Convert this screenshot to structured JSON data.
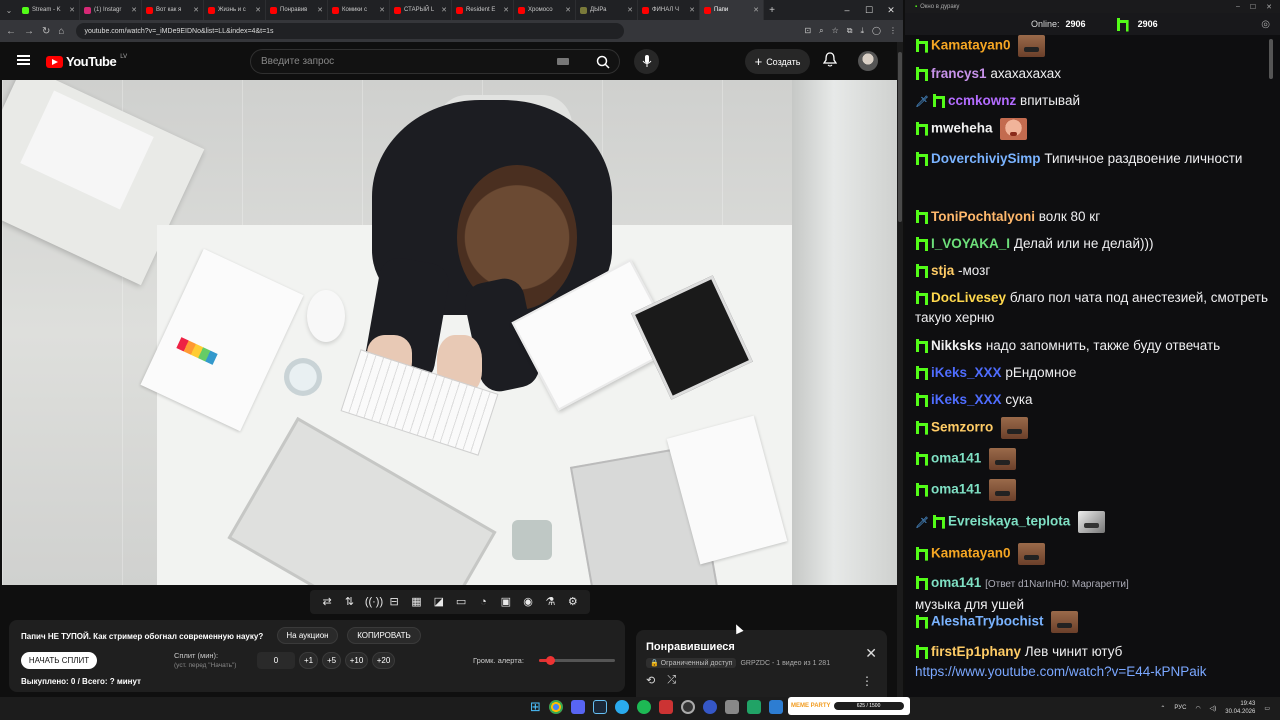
{
  "browser": {
    "tabs": [
      {
        "label": "Stream - K",
        "color": "#53fc18"
      },
      {
        "label": "(1) Instagr",
        "color": "#d62976"
      },
      {
        "label": "Вот как я",
        "color": "#ff0000"
      },
      {
        "label": "Жизнь и с",
        "color": "#ff0000"
      },
      {
        "label": "Понравив",
        "color": "#ff0000"
      },
      {
        "label": "Комики с",
        "color": "#ff0000"
      },
      {
        "label": "СТАРЫЙ L",
        "color": "#ff0000"
      },
      {
        "label": "Resident E",
        "color": "#ff0000"
      },
      {
        "label": "Хромосо",
        "color": "#ff0000"
      },
      {
        "label": "ДЫРа",
        "color": "#7a7a3a"
      },
      {
        "label": "ФИНАЛ Ч",
        "color": "#ff0000"
      },
      {
        "label": "Папи",
        "color": "#ff0000"
      }
    ],
    "url": "youtube.com/watch?v=_iMDe9EIDNo&list=LL&index=4&t=1s"
  },
  "youtube": {
    "logo_text": "YouTube",
    "region": "LV",
    "search_placeholder": "Введите запрос",
    "create_label": "Создать"
  },
  "split_widget": {
    "title": "Папич НЕ ТУПОЙ. Как стример обогнал современную науку?",
    "auction_btn": "На аукцион",
    "copy_btn": "КОПИРОВАТЬ",
    "start_btn": "НАЧАТЬ СПЛИТ",
    "split_label": "Сплит (мин):",
    "split_sub": "(уст. перед \"Начать\")",
    "split_value": "0",
    "inc_buttons": [
      "+1",
      "+5",
      "+10",
      "+20"
    ],
    "volume_label": "Громк. алерта:",
    "volume_level": 0.15,
    "stats": "Выкуплено: 0 / Всего: ? минут"
  },
  "liked_panel": {
    "title": "Понравившиеся",
    "access": "Ограниченный доступ",
    "meta": "GRPZDC - 1 видео из 1 281"
  },
  "chat": {
    "window_title": "Окно в дураку",
    "online_label": "Online:",
    "online_count": "2906",
    "kick_count": "2906",
    "messages": [
      {
        "user": "Kamatayan0",
        "color": "#f5a623",
        "text": "",
        "emote": "mouth"
      },
      {
        "user": "francys1",
        "color": "#c792ea",
        "text": "ахахахахах"
      },
      {
        "user": "ccmkownz",
        "color": "#b36cff",
        "text": "впитывай",
        "sword": true
      },
      {
        "user": "mweheha",
        "color": "#f1f1f1",
        "text": "",
        "emote": "face"
      },
      {
        "user": "DoverchiviySimp",
        "color": "#7ab3ff",
        "text": "Типичное раздвоение личности"
      },
      {
        "user": "ToniPochtalyoni",
        "color": "#ffb86c",
        "text": "волк 80 кг"
      },
      {
        "user": "I_VOYAKA_I",
        "color": "#6de07a",
        "text": "Делай или не делай)))"
      },
      {
        "user": "stja",
        "color": "#ffcc66",
        "text": "-мозг"
      },
      {
        "user": "DocLivesey",
        "color": "#ffd84d",
        "text": "благо пол чата под анестезией, смотреть такую херню"
      },
      {
        "user": "Nikksks",
        "color": "#f1f1f1",
        "text": "надо запомнить, также буду отвечать"
      },
      {
        "user": "iKeks_XXX",
        "color": "#4f6dff",
        "text": "рЕндомное"
      },
      {
        "user": "iKeks_XXX",
        "color": "#4f6dff",
        "text": "сука"
      },
      {
        "user": "Semzorro",
        "color": "#ffcc66",
        "text": "",
        "emote": "mouth"
      },
      {
        "user": "oma141",
        "color": "#7fe0c4",
        "text": "",
        "emote": "mouth"
      },
      {
        "user": "oma141",
        "color": "#7fe0c4",
        "text": "",
        "emote": "mouth"
      },
      {
        "user": "Evreiskaya_teplota",
        "color": "#7fe0c4",
        "text": "",
        "emote": "bw",
        "sword": true
      },
      {
        "user": "Kamatayan0",
        "color": "#f5a623",
        "text": "",
        "emote": "mouth"
      },
      {
        "user": "oma141",
        "color": "#7fe0c4",
        "reply": "[Ответ d1NarInH0: Маргаретти]",
        "text": "музыка для ушей"
      },
      {
        "user": "AleshaTrybochist",
        "color": "#7ab3ff",
        "text": "",
        "emote": "mouth"
      },
      {
        "user": "firstEp1phany",
        "color": "#ffcc66",
        "text": "Лев чинит ютуб",
        "link": "https://www.youtube.com/watch?v=E44-kPNPaik"
      }
    ]
  },
  "taskbar": {
    "widget_title": "MEME PARTY",
    "widget_progress": "625 / 1500",
    "lang": "РУС",
    "time": "19:43",
    "date": "30.04.2026"
  }
}
